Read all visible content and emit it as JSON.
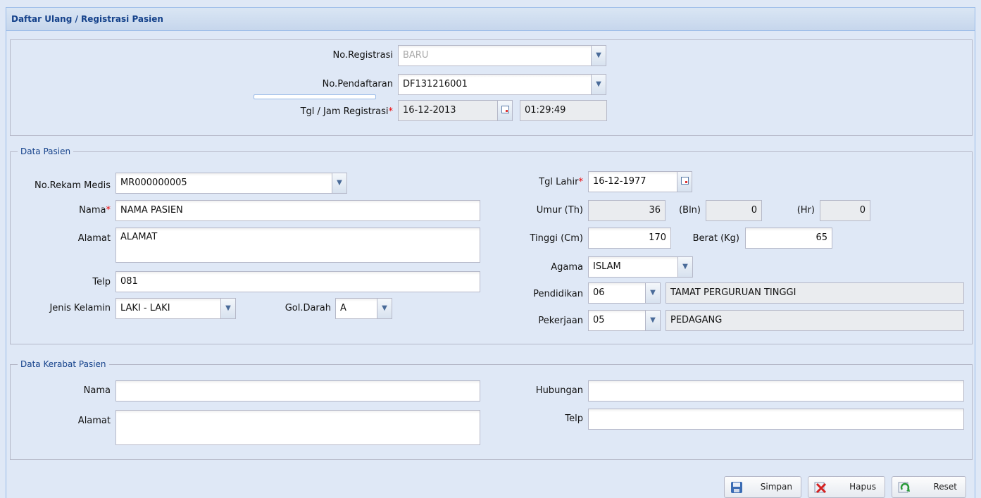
{
  "header": {
    "title": "Daftar Ulang / Registrasi Pasien"
  },
  "registrasi": {
    "no_registrasi_label": "No.Registrasi",
    "no_registrasi_value": "BARU",
    "no_pendaftaran_label": "No.Pendaftaran",
    "no_pendaftaran_value": "DF131216001",
    "tgl_jam_label": "Tgl / Jam Registrasi",
    "required_mark": "*",
    "tgl_value": "16-12-2013",
    "jam_value": "01:29:49",
    "progress": 0
  },
  "data_pasien": {
    "legend": "Data Pasien",
    "no_rm_label": "No.Rekam Medis",
    "no_rm_value": "MR000000005",
    "nama_label": "Nama",
    "nama_value": "NAMA PASIEN",
    "alamat_label": "Alamat",
    "alamat_value": "ALAMAT",
    "telp_label": "Telp",
    "telp_value": "081",
    "jenis_kelamin_label": "Jenis Kelamin",
    "jenis_kelamin_value": "LAKI - LAKI",
    "gol_darah_label": "Gol.Darah",
    "gol_darah_value": "A",
    "tgl_lahir_label": "Tgl Lahir",
    "tgl_lahir_value": "16-12-1977",
    "umur_th_label": "Umur (Th)",
    "umur_th_value": "36",
    "umur_bln_label": "(Bln)",
    "umur_bln_value": "0",
    "umur_hr_label": "(Hr)",
    "umur_hr_value": "0",
    "tinggi_label": "Tinggi (Cm)",
    "tinggi_value": "170",
    "berat_label": "Berat (Kg)",
    "berat_value": "65",
    "agama_label": "Agama",
    "agama_value": "ISLAM",
    "pendidikan_label": "Pendidikan",
    "pendidikan_code": "06",
    "pendidikan_desc": "TAMAT PERGURUAN TINGGI",
    "pekerjaan_label": "Pekerjaan",
    "pekerjaan_code": "05",
    "pekerjaan_desc": "PEDAGANG"
  },
  "data_kerabat": {
    "legend": "Data Kerabat Pasien",
    "nama_label": "Nama",
    "nama_value": "",
    "alamat_label": "Alamat",
    "alamat_value": "",
    "hubungan_label": "Hubungan",
    "hubungan_value": "",
    "telp_label": "Telp",
    "telp_value": ""
  },
  "buttons": {
    "simpan": "Simpan",
    "hapus": "Hapus",
    "reset": "Reset"
  },
  "icons": {
    "dropdown": "chevron-down-icon",
    "calendar": "calendar-icon",
    "save": "floppy-disk-icon",
    "delete": "red-x-icon",
    "reset": "refresh-icon"
  },
  "colors": {
    "title": "#15428b",
    "required": "#ee0000",
    "panel_bg": "#dfe8f6",
    "border": "#99bbe8"
  }
}
